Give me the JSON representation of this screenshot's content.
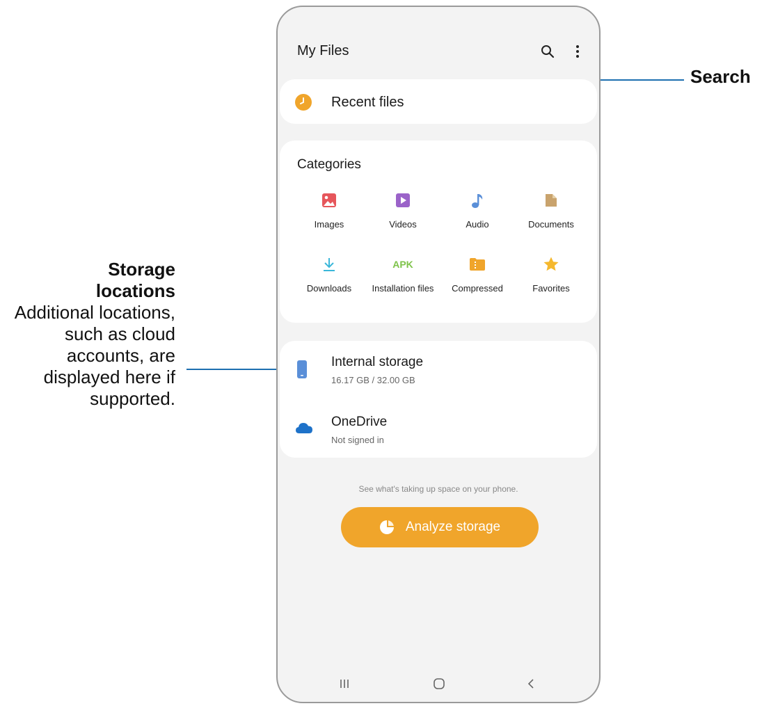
{
  "callouts": {
    "search": "Search",
    "storage_title_line1": "Storage",
    "storage_title_line2": "locations",
    "storage_desc": "Additional locations, such as cloud accounts, are displayed here if supported."
  },
  "app": {
    "title": "My Files",
    "toolbar": {
      "search_icon": "search-icon",
      "more_icon": "more-options-icon"
    }
  },
  "recent": {
    "label": "Recent files",
    "icon": "clock-icon",
    "color": "#f0a52b"
  },
  "categories": {
    "heading": "Categories",
    "items": [
      {
        "label": "Images",
        "icon": "image-icon",
        "color": "#e6565b"
      },
      {
        "label": "Videos",
        "icon": "video-icon",
        "color": "#9b63c9"
      },
      {
        "label": "Audio",
        "icon": "music-note-icon",
        "color": "#5a8fd8"
      },
      {
        "label": "Documents",
        "icon": "document-icon",
        "color": "#c9a36d"
      },
      {
        "label": "Downloads",
        "icon": "download-icon",
        "color": "#3ab7d9"
      },
      {
        "label": "Installation files",
        "icon_text": "APK",
        "icon": "apk-icon",
        "color": "#7ec34a"
      },
      {
        "label": "Compressed",
        "icon": "folder-zip-icon",
        "color": "#f0a52b"
      },
      {
        "label": "Favorites",
        "icon": "star-icon",
        "color": "#f5b82e"
      }
    ]
  },
  "storage": {
    "items": [
      {
        "name": "Internal storage",
        "detail": "16.17 GB / 32.00 GB",
        "icon": "phone-icon",
        "color": "#5a8fd8"
      },
      {
        "name": "OneDrive",
        "detail": "Not signed in",
        "icon": "cloud-icon",
        "color": "#1e72c9"
      }
    ]
  },
  "analyze": {
    "hint": "See what's taking up space on your phone.",
    "button_label": "Analyze storage",
    "button_color": "#f0a52b"
  },
  "navbar": {
    "recents_icon": "recents-icon",
    "home_icon": "home-icon",
    "back_icon": "back-icon"
  }
}
